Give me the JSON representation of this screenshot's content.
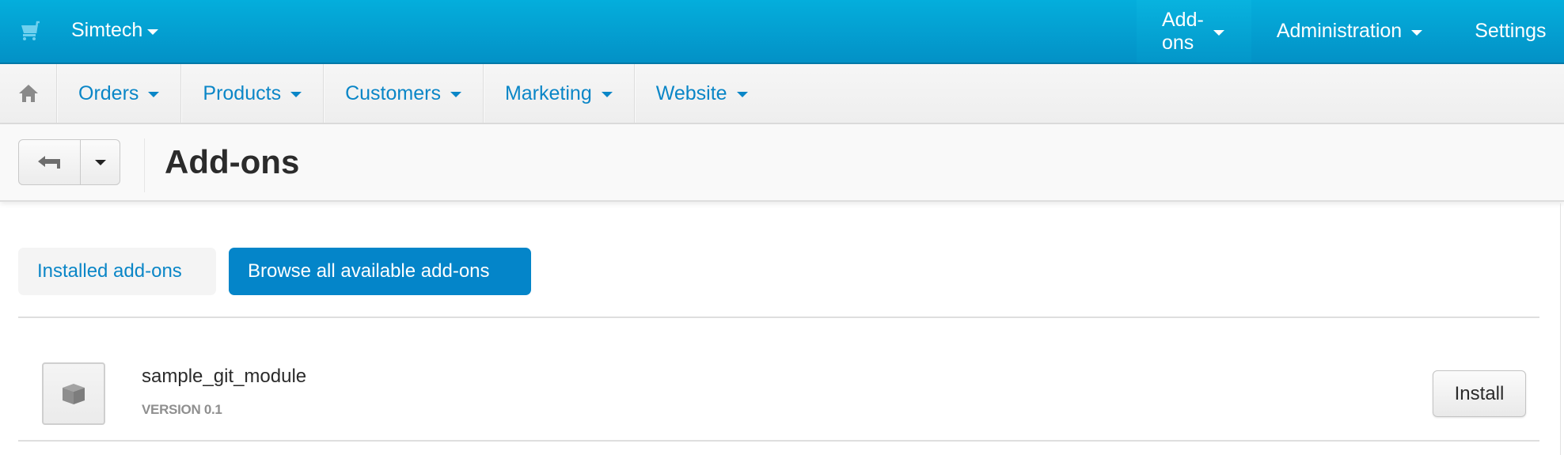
{
  "topbar": {
    "brand": "Simtech",
    "nav": [
      {
        "label": "Add-ons",
        "active": true
      },
      {
        "label": "Administration",
        "active": false
      },
      {
        "label": "Settings",
        "active": false
      }
    ]
  },
  "subnav": {
    "items": [
      {
        "label": "Orders"
      },
      {
        "label": "Products"
      },
      {
        "label": "Customers"
      },
      {
        "label": "Marketing"
      },
      {
        "label": "Website"
      }
    ]
  },
  "toolbar": {
    "title": "Add-ons"
  },
  "tabs": [
    {
      "label": "Installed add-ons",
      "active": false
    },
    {
      "label": "Browse all available add-ons",
      "active": true
    }
  ],
  "addons": [
    {
      "name": "sample_git_module",
      "version": "VERSION 0.1",
      "action_label": "Install"
    }
  ],
  "colors": {
    "topbar": "#0391c6",
    "accent": "#0485c9",
    "link": "#0a86c7"
  }
}
